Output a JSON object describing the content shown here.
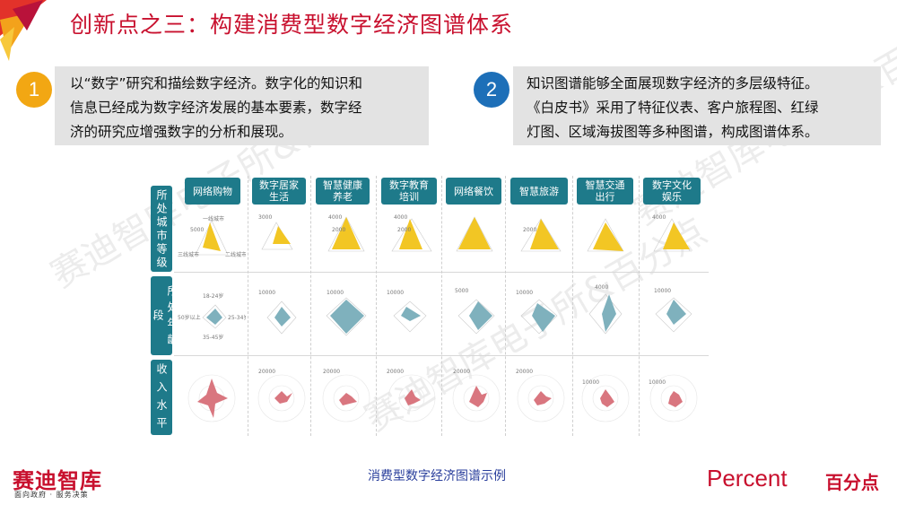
{
  "title": "创新点之三：构建消费型数字经济图谱体系",
  "point1": {
    "number": "1",
    "lines": [
      "以“数字”研究和描绘数字经济。数字化的知识和",
      "信息已经成为数字经济发展的基本要素，数字经",
      "济的研究应增强数字的分析和展现。"
    ]
  },
  "point2": {
    "number": "2",
    "lines": [
      "知识图谱能够全面展现数字经济的多层级特征。",
      "《白皮书》采用了特征仪表、客户旅程图、红绿",
      "灯图、区域海拔图等多种图谱，构成图谱体系。"
    ]
  },
  "chart": {
    "columns": [
      [
        "网络购物"
      ],
      [
        "数字居家",
        "生活"
      ],
      [
        "智慧健康",
        "养老"
      ],
      [
        "数字教育",
        "培训"
      ],
      [
        "网络餐饮"
      ],
      [
        "智慧旅游"
      ],
      [
        "智慧交通",
        "出行"
      ],
      [
        "数字文化",
        "娱乐"
      ]
    ],
    "rows": [
      "所处城市等级",
      "所处年龄段",
      "收入水平"
    ],
    "row1_ticks": [
      "5000",
      "3000",
      "4000",
      "2000",
      "4000",
      "2000",
      "2000",
      "4000"
    ],
    "row2_ticks": [
      "10000",
      "10000",
      "10000",
      "5000",
      "10000",
      "4000",
      "10000"
    ],
    "row3_ticks": [
      "20000",
      "20000",
      "20000",
      "20000",
      "20000",
      "10000",
      "10000"
    ],
    "first_row_labels": [
      "一线城市",
      "三线城市",
      "二线城市"
    ],
    "age_labels": [
      "18-24岁",
      "25-34岁",
      "35-45岁",
      "50岁以上"
    ],
    "caption": "消费型数字经济图谱示例"
  },
  "brand_left": {
    "name": "赛迪智库",
    "slogan": "面向政府 · 服务决策"
  },
  "brand_right": {
    "name": "Percent",
    "cn": "百分点"
  },
  "watermark": [
    "赛迪智库电子所&百分点",
    "赛迪智库电子所&百分点",
    "赛迪智库电子所&百分点"
  ],
  "colors": {
    "red": "#c8102e",
    "teal": "#1e7a8a",
    "yellow": "#f2c624",
    "bluegray": "#7fb1bd",
    "pink": "#d9767f"
  }
}
